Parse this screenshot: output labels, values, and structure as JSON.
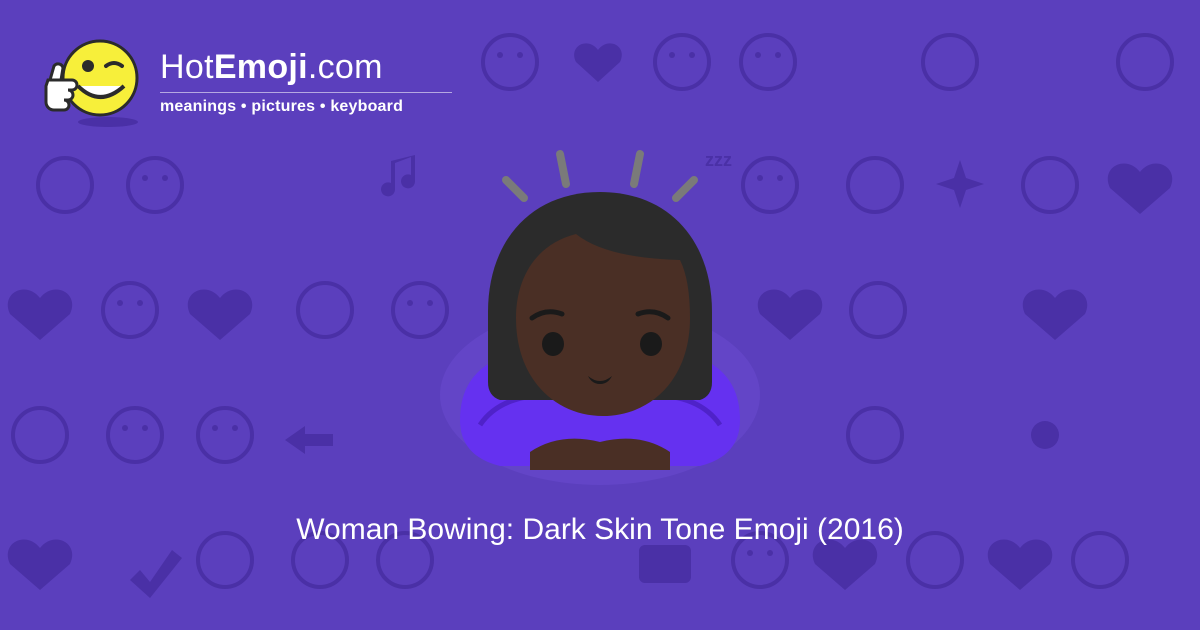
{
  "site": {
    "name_prefix": "Hot",
    "name_bold": "Emoji",
    "name_suffix": ".com",
    "tagline": "meanings • pictures • keyboard",
    "logo_icon": "thumbs-up-wink-face-icon"
  },
  "hero": {
    "icon": "woman-bowing-dark-skin-tone-emoji",
    "caption": "Woman Bowing: Dark Skin Tone Emoji (2016)"
  },
  "colors": {
    "background": "#5b3fbd",
    "pattern": "#4a30a6",
    "logo_yellow": "#f7ef3a",
    "shirt": "#6531f0",
    "skin": "#4a2f25",
    "hair": "#2b2b2b"
  },
  "background_pattern": {
    "icons": [
      "heart-icon",
      "grinning-face-icon",
      "winking-kiss-face-icon",
      "two-hearts-icon",
      "smiling-face-icon",
      "weary-face-icon",
      "ok-hand-icon",
      "neutral-face-icon",
      "eyes-icon",
      "unamused-face-icon",
      "relieved-face-icon",
      "broken-heart-icon",
      "recycle-icon",
      "raised-hands-icon",
      "music-notes-icon",
      "zzz-icon",
      "sparkles-icon",
      "striped-heart-icon",
      "tongue-face-icon",
      "sad-face-icon",
      "heart-arrow-icon",
      "monkey-icon",
      "angry-devil-icon",
      "left-arrow-icon",
      "fire-icon",
      "rose-icon",
      "sun-icon",
      "flexed-biceps-icon",
      "check-mark-icon",
      "camera-icon",
      "screaming-face-icon"
    ]
  }
}
